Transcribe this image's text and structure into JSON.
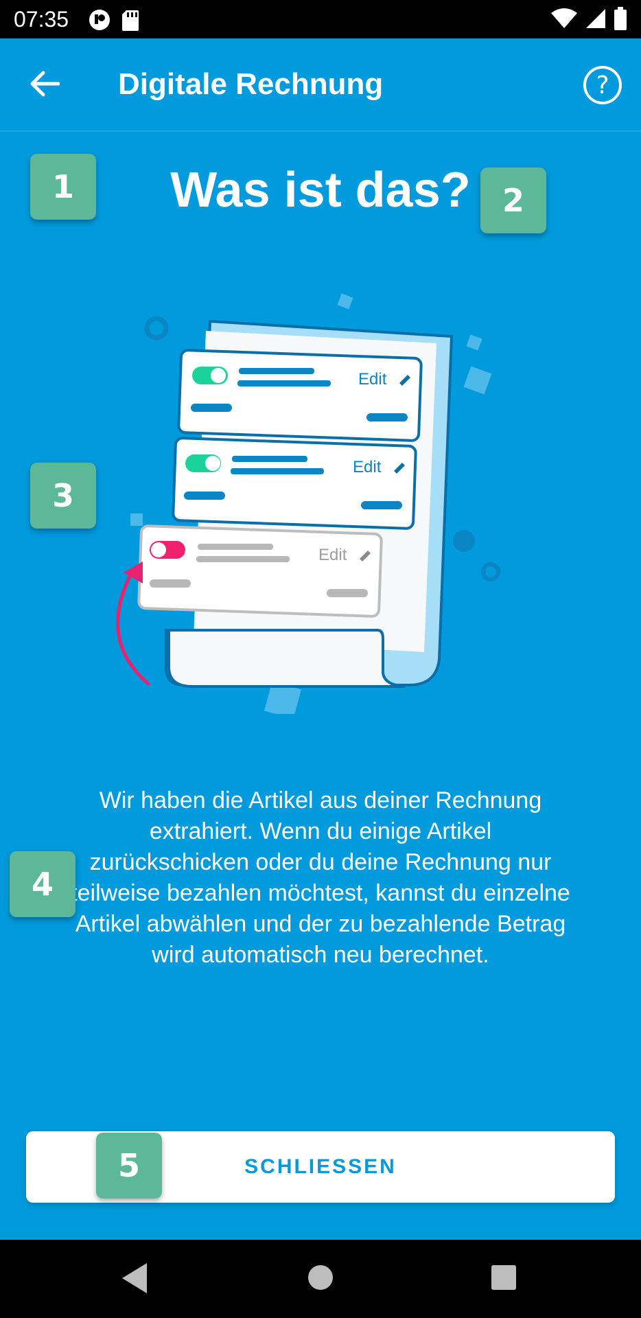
{
  "status_bar": {
    "time": "07:35"
  },
  "app_bar": {
    "title": "Digitale Rechnung",
    "back_icon": "arrow-left-icon",
    "help_label": "?"
  },
  "content": {
    "heading": "Was ist das?",
    "description": "Wir haben die Artikel aus deiner Rechnung extrahiert. Wenn du einige Artikel zurückschicken oder du deine Rechnung nur teilweise bezahlen möchtest, kannst du einzelne Artikel abwählen und der zu bezahlende Betrag wird automatisch neu berechnet.",
    "illustration": {
      "edit_labels": [
        "Edit",
        "Edit",
        "Edit"
      ]
    }
  },
  "close_button": {
    "label": "SCHLIESSEN"
  },
  "badges": [
    "1",
    "2",
    "3",
    "4",
    "5"
  ],
  "colors": {
    "background": "#019ADC",
    "badge": "#5DB89A",
    "button_text": "#0998D9",
    "toggle_on": "#1BD39A",
    "toggle_off": "#F0226E"
  }
}
